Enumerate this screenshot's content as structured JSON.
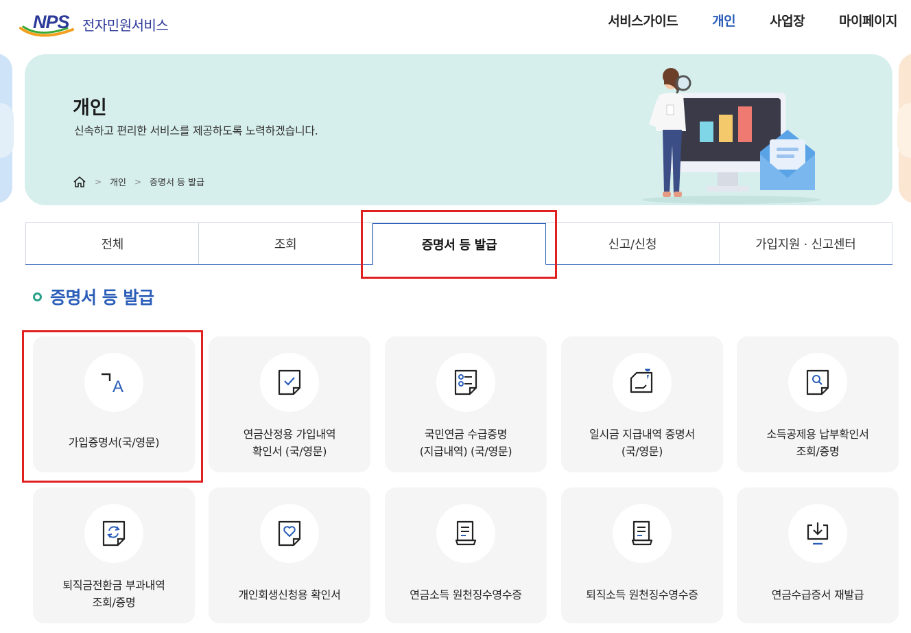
{
  "header": {
    "logo_letters": "NPS",
    "service_name": "전자민원서비스",
    "nav": [
      {
        "label": "서비스가이드"
      },
      {
        "label": "개인"
      },
      {
        "label": "사업장"
      },
      {
        "label": "마이페이지"
      }
    ],
    "active_nav": "개인"
  },
  "banner": {
    "title": "개인",
    "subtitle": "신속하고 편리한 서비스를 제공하도록 노력하겠습니다.",
    "breadcrumb": [
      "개인",
      "증명서 등 발급"
    ]
  },
  "tabs": [
    {
      "label": "전체"
    },
    {
      "label": "조회"
    },
    {
      "label": "증명서 등 발급"
    },
    {
      "label": "신고/신청"
    },
    {
      "label": "가입지원 · 신고센터"
    }
  ],
  "active_tab": "증명서 등 발급",
  "section": {
    "title": "증명서 등 발급"
  },
  "cards": [
    {
      "label": "가입증명서(국/영문)",
      "icon": "translate-icon"
    },
    {
      "label": "연금산정용 가입내역\n확인서 (국/영문)",
      "icon": "document-check-icon"
    },
    {
      "label": "국민연금 수급증명\n(지급내역) (국/영문)",
      "icon": "document-list-icon"
    },
    {
      "label": "일시금 지급내역 증명서\n(국/영문)",
      "icon": "document-pin-icon"
    },
    {
      "label": "소득공제용 납부확인서\n조회/증명",
      "icon": "document-search-icon"
    },
    {
      "label": "퇴직금전환금 부과내역\n조회/증명",
      "icon": "document-refresh-icon"
    },
    {
      "label": "개인회생신청용 확인서",
      "icon": "document-heart-icon"
    },
    {
      "label": "연금소득 원천징수영수증",
      "icon": "receipt-icon"
    },
    {
      "label": "퇴직소득 원천징수영수증",
      "icon": "receipt-icon"
    },
    {
      "label": "연금수급증서 재발급",
      "icon": "download-icon"
    }
  ],
  "colors": {
    "brand": "#2c3a98",
    "accent": "#2a5db8",
    "banner_bg": "#d6efec",
    "card_bg": "#f5f5f5",
    "highlight": "#e02020"
  }
}
